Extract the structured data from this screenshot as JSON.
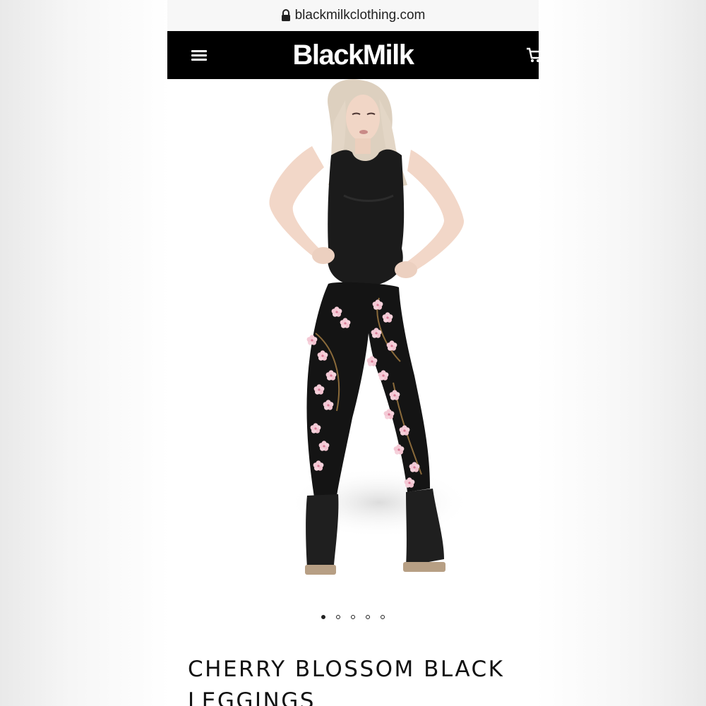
{
  "browser": {
    "url": "blackmilkclothing.com",
    "lock_icon": "lock-icon"
  },
  "header": {
    "logo_text": "BlackMilk",
    "menu_icon": "hamburger-menu-icon",
    "cart_icon": "cart-icon",
    "background_color": "#000000"
  },
  "product": {
    "image_description_icon": "product-photo",
    "carousel": {
      "total": 5,
      "active_index": 0
    },
    "title": "CHERRY BLOSSOM BLACK LEGGINGS"
  }
}
